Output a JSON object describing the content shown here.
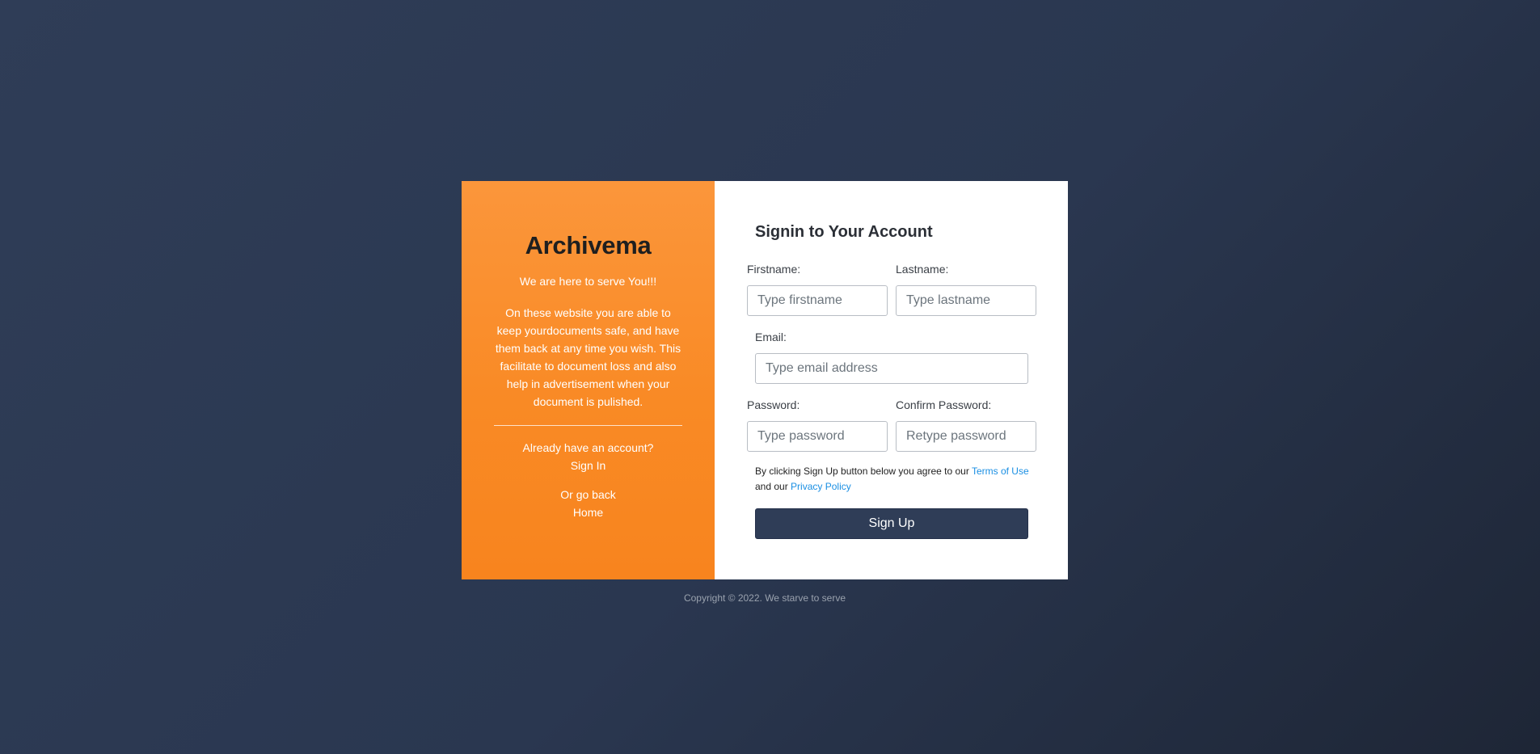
{
  "left_panel": {
    "brand": "Archivema",
    "tagline": "We are here to serve You!!!",
    "description": "On these website you are able to keep yourdocuments safe, and have them back at any time you wish. This facilitate to document loss and also help in advertisement when your document is pulished.",
    "signin_prompt": "Already have an account?",
    "signin_link": "Sign In",
    "home_prompt": "Or go back",
    "home_link": "Home"
  },
  "form": {
    "title": "Signin to Your Account",
    "firstname": {
      "label": "Firstname:",
      "placeholder": "Type firstname",
      "value": ""
    },
    "lastname": {
      "label": "Lastname:",
      "placeholder": "Type lastname",
      "value": ""
    },
    "email": {
      "label": "Email:",
      "placeholder": "Type email address",
      "value": ""
    },
    "password": {
      "label": "Password:",
      "placeholder": "Type password",
      "value": ""
    },
    "confirm_password": {
      "label": "Confirm Password:",
      "placeholder": "Retype password",
      "value": ""
    },
    "legal_prefix": "By clicking Sign Up button below you agree to our",
    "terms_link": "Terms of Use",
    "legal_middle": "and our",
    "privacy_link": "Privacy Policy",
    "submit_label": "Sign Up"
  },
  "footer": {
    "copyright": "Copyright © 2022. We starve to serve"
  },
  "colors": {
    "accent_orange": "#f98a25",
    "primary_navy": "#2f3d57",
    "link_blue": "#1a8fe3"
  }
}
